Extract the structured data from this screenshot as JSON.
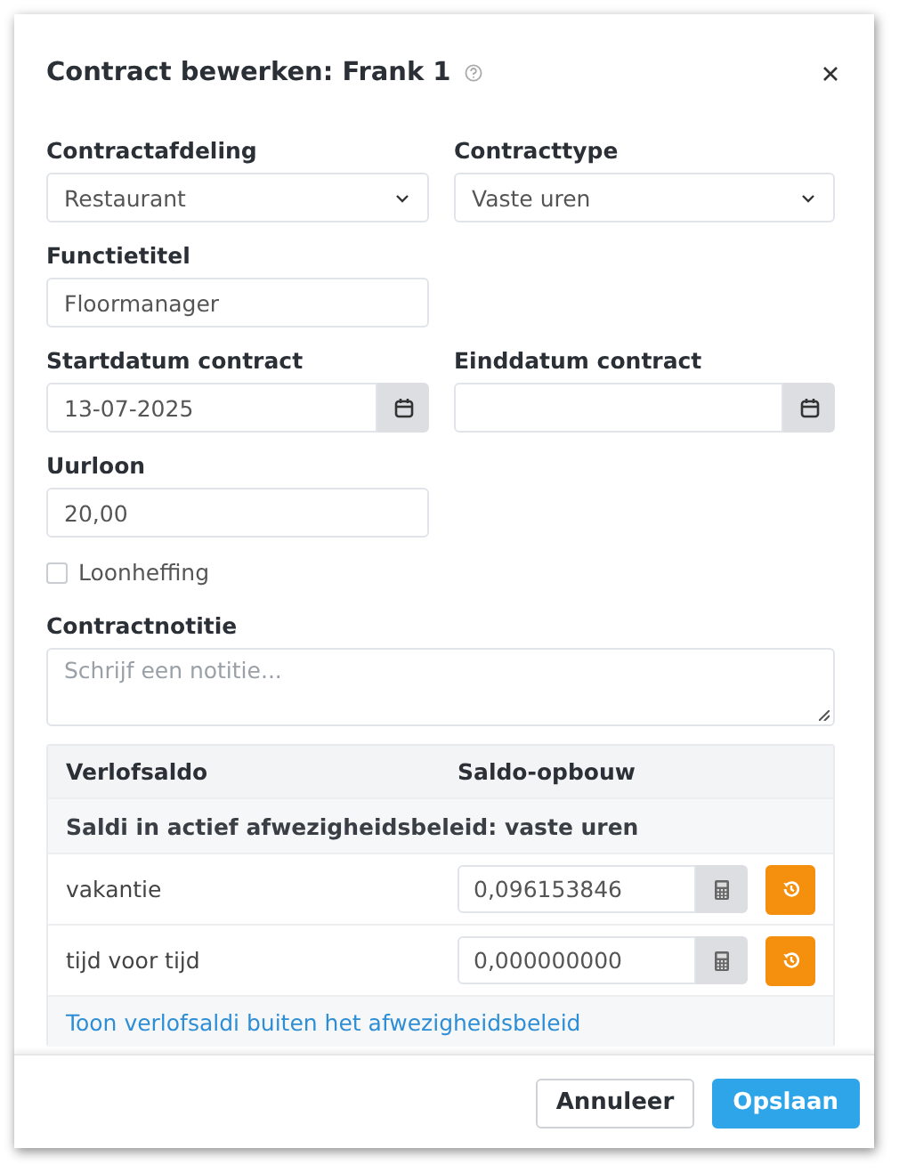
{
  "dialog": {
    "title": "Contract bewerken: Frank 1"
  },
  "form_rows": [
    [
      {
        "kind": "select",
        "label": "Contractafdeling",
        "value": "Restaurant"
      },
      {
        "kind": "select",
        "label": "Contracttype",
        "value": "Vaste uren"
      }
    ],
    [
      {
        "kind": "text",
        "label": "Functietitel",
        "value": "Floormanager"
      }
    ],
    [
      {
        "kind": "date",
        "label": "Startdatum contract",
        "value": "13-07-2025"
      },
      {
        "kind": "date",
        "label": "Einddatum contract"
      }
    ],
    [
      {
        "kind": "text",
        "label": "Uurloon",
        "value": "20,00"
      }
    ],
    [
      {
        "kind": "checkbox",
        "label": "Loonheffing",
        "checked": false
      }
    ],
    [
      {
        "kind": "textarea",
        "label": "Contractnotitie",
        "placeholder": "Schrijf een notitie..."
      }
    ]
  ],
  "leave_table": {
    "columns": [
      "Verlofsaldo",
      "Saldo-opbouw"
    ],
    "group": "Saldi in actief afwezigheidsbeleid: vaste uren",
    "rows": [
      {
        "name": "vakantie",
        "value": "0,096153846"
      },
      {
        "name": "tijd voor tijd",
        "value": "0,000000000"
      }
    ],
    "link": "Toon verlofsaldi buiten het afwezigheidsbeleid"
  },
  "buttons": [
    {
      "label": "Annuleer",
      "kind": "secondary"
    },
    {
      "label": "Opslaan",
      "kind": "primary"
    }
  ]
}
